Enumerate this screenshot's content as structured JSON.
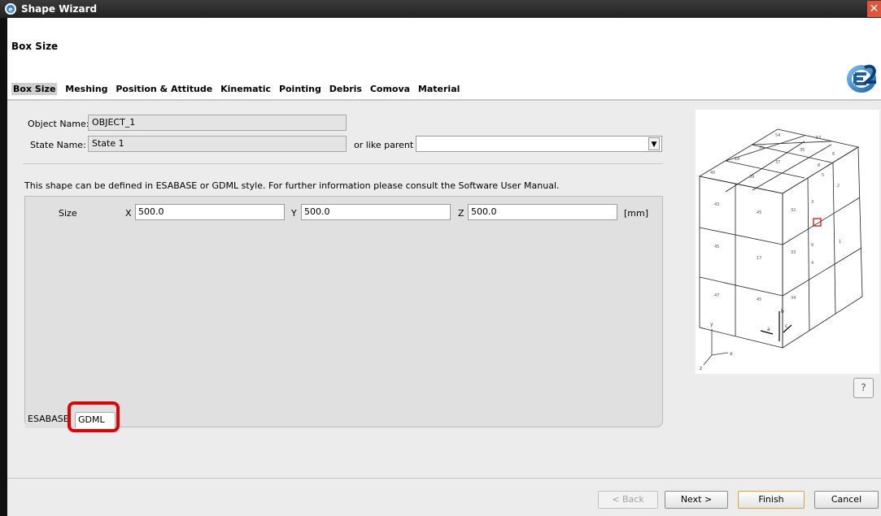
{
  "window": {
    "title": "Shape Wizard",
    "close": "✕"
  },
  "page": {
    "title": "Box Size"
  },
  "steps": [
    {
      "label": "Box Size",
      "active": true
    },
    {
      "label": "Meshing"
    },
    {
      "label": "Position & Attitude"
    },
    {
      "label": "Kinematic"
    },
    {
      "label": "Pointing"
    },
    {
      "label": "Debris"
    },
    {
      "label": "Comova"
    },
    {
      "label": "Material"
    }
  ],
  "object": {
    "label": "Object Name:",
    "value": "OBJECT_1"
  },
  "state": {
    "label": "State Name:",
    "value": "State 1",
    "like_parent_label": "or like parent",
    "like_parent_value": ""
  },
  "info": "This shape can be defined in ESABASE or GDML style. For further information please consult the Software User Manual.",
  "size": {
    "label": "Size",
    "x_label": "X",
    "x_value": "500.0",
    "y_label": "Y",
    "y_value": "500.0",
    "z_label": "Z",
    "z_value": "500.0",
    "unit": "[mm]"
  },
  "tabs": {
    "esabase": "ESABASE",
    "gdml": "GDML"
  },
  "help": "?",
  "buttons": {
    "back": "< Back",
    "next": "Next >",
    "finish": "Finish",
    "cancel": "Cancel"
  },
  "colors": {
    "highlight": "#e00000",
    "titlebar": "#2a2a2a",
    "marker": "#cc0000"
  }
}
